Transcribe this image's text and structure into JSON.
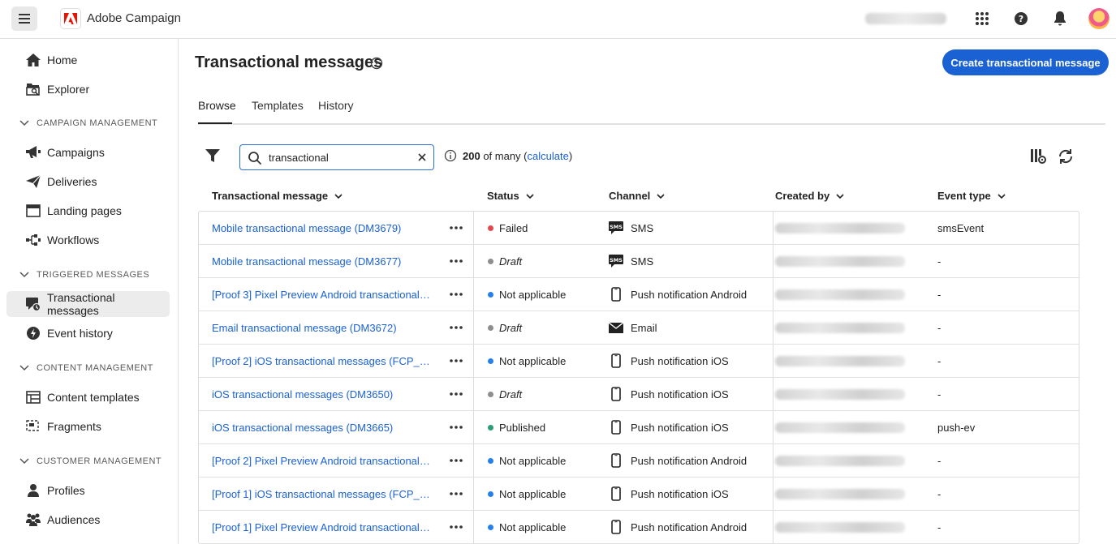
{
  "app": {
    "name": "Adobe Campaign"
  },
  "sidebar": {
    "items": [
      {
        "label": "Home",
        "icon": "home-icon"
      },
      {
        "label": "Explorer",
        "icon": "explorer-icon"
      },
      {
        "section": "CAMPAIGN MANAGEMENT"
      },
      {
        "label": "Campaigns",
        "icon": "megaphone-icon"
      },
      {
        "label": "Deliveries",
        "icon": "send-icon"
      },
      {
        "label": "Landing pages",
        "icon": "landing-page-icon"
      },
      {
        "label": "Workflows",
        "icon": "workflow-icon"
      },
      {
        "section": "TRIGGERED MESSAGES"
      },
      {
        "label": "Transactional messages",
        "icon": "transactional-icon",
        "selected": true
      },
      {
        "label": "Event history",
        "icon": "event-history-icon"
      },
      {
        "section": "CONTENT MANAGEMENT"
      },
      {
        "label": "Content templates",
        "icon": "content-templates-icon"
      },
      {
        "label": "Fragments",
        "icon": "fragments-icon"
      },
      {
        "section": "CUSTOMER MANAGEMENT"
      },
      {
        "label": "Profiles",
        "icon": "profile-icon"
      },
      {
        "label": "Audiences",
        "icon": "audiences-icon"
      }
    ]
  },
  "page": {
    "title": "Transactional messages",
    "create_label": "Create transactional message",
    "tabs": [
      "Browse",
      "Templates",
      "History"
    ]
  },
  "search": {
    "value": "transactional"
  },
  "count": {
    "number": "200",
    "text": " of many (",
    "link": "calculate",
    "close": ")"
  },
  "table": {
    "headers": [
      "Transactional message",
      "Status",
      "Channel",
      "Created by",
      "Event type"
    ],
    "rows": [
      {
        "name": "Mobile transactional message (DM3679)",
        "status": "Failed",
        "status_color": "#e34850",
        "channel": "SMS",
        "channel_icon": "sms-icon",
        "event": "smsEvent"
      },
      {
        "name": "Mobile transactional message (DM3677)",
        "status": "Draft",
        "status_color": "#8e8e8e",
        "channel": "SMS",
        "channel_icon": "sms-icon",
        "event": "-"
      },
      {
        "name": "[Proof 3] Pixel Preview Android transactional ...",
        "status": "Not applicable",
        "status_color": "#2680eb",
        "channel": "Push notification Android",
        "channel_icon": "mobile-icon",
        "event": "-"
      },
      {
        "name": "Email transactional message (DM3672)",
        "status": "Draft",
        "status_color": "#8e8e8e",
        "channel": "Email",
        "channel_icon": "email-icon",
        "event": "-"
      },
      {
        "name": "[Proof 2] iOS transactional messages (FCP_5...",
        "status": "Not applicable",
        "status_color": "#2680eb",
        "channel": "Push notification iOS",
        "channel_icon": "mobile-icon",
        "event": "-"
      },
      {
        "name": "iOS transactional messages (DM3650)",
        "status": "Draft",
        "status_color": "#8e8e8e",
        "channel": "Push notification iOS",
        "channel_icon": "mobile-icon",
        "event": "-"
      },
      {
        "name": "iOS transactional messages (DM3665)",
        "status": "Published",
        "status_color": "#2d9d78",
        "channel": "Push notification iOS",
        "channel_icon": "mobile-icon",
        "event": "push-ev"
      },
      {
        "name": "[Proof 2] Pixel Preview Android transactional ...",
        "status": "Not applicable",
        "status_color": "#2680eb",
        "channel": "Push notification Android",
        "channel_icon": "mobile-icon",
        "event": "-"
      },
      {
        "name": "[Proof 1] iOS transactional messages (FCP_53...",
        "status": "Not applicable",
        "status_color": "#2680eb",
        "channel": "Push notification iOS",
        "channel_icon": "mobile-icon",
        "event": "-"
      },
      {
        "name": "[Proof 1] Pixel Preview Android transactional ...",
        "status": "Not applicable",
        "status_color": "#2680eb",
        "channel": "Push notification Android",
        "channel_icon": "mobile-icon",
        "event": "-"
      }
    ]
  }
}
